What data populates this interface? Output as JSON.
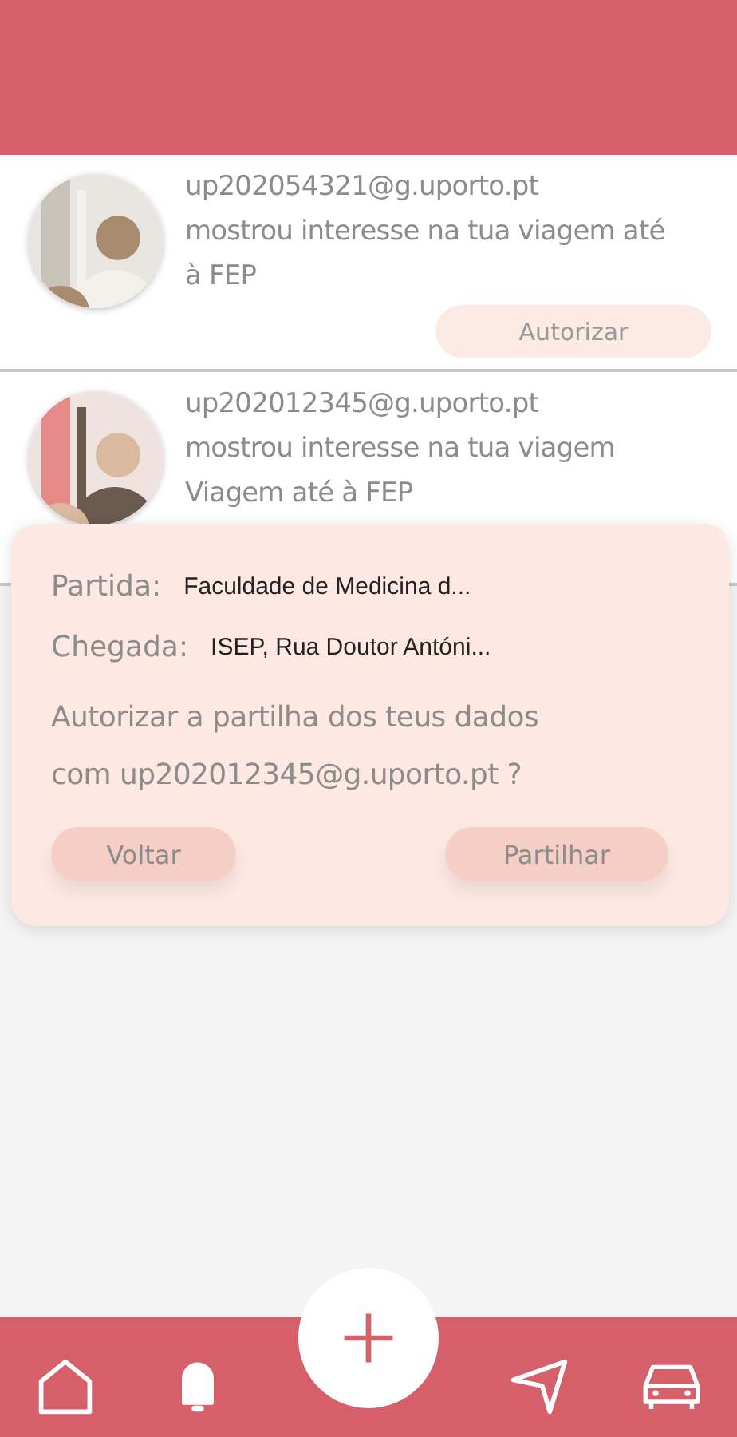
{
  "notifications": [
    {
      "kind": "picture",
      "email": "up202054321@g.uporto.pt",
      "lines": [
        "mostrou interesse na tua viagem até",
        "à FEP"
      ],
      "button": "Autorizar"
    },
    {
      "kind": "picture",
      "email": "up202012345@g.uporto.pt",
      "lines": [
        "mostrou interesse na tua viagem",
        "Viagem até à FEP"
      ]
    }
  ],
  "dialog": {
    "fields": [
      {
        "label": "Partida:",
        "value": "Faculdade de Medicina d..."
      },
      {
        "label": "Chegada:",
        "value": "ISEP, Rua Doutor Antóni..."
      }
    ],
    "question": [
      "Autorizar a partilha dos teus dados",
      "com up202012345@g.uporto.pt ?"
    ],
    "buttons": [
      "Voltar",
      "Partilhar"
    ]
  }
}
